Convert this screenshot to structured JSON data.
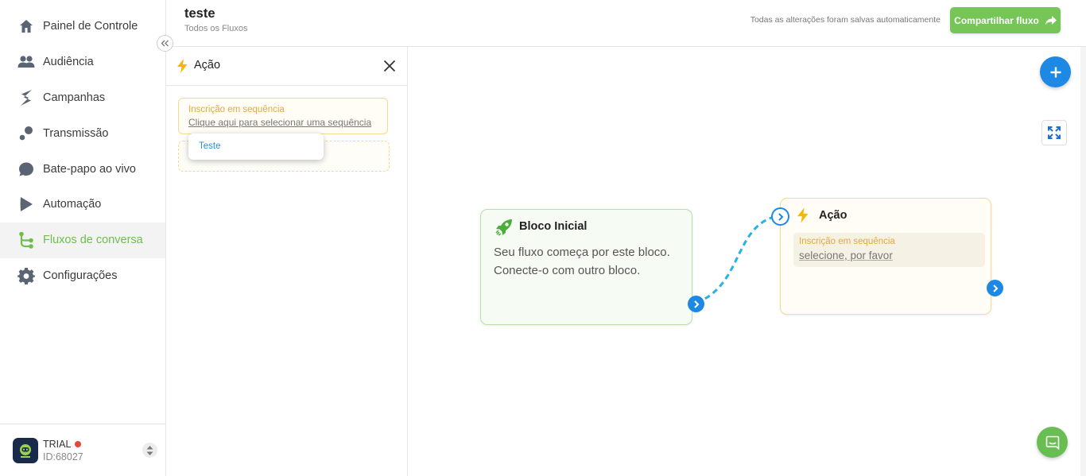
{
  "colors": {
    "accent_green": "#75c656",
    "accent_blue": "#1e88e5",
    "warning": "#e5a935"
  },
  "sidebar": {
    "items": [
      {
        "label": "Painel de Controle",
        "icon": "home-icon"
      },
      {
        "label": "Audiência",
        "icon": "users-icon"
      },
      {
        "label": "Campanhas",
        "icon": "campaign-icon"
      },
      {
        "label": "Transmissão",
        "icon": "broadcast-icon"
      },
      {
        "label": "Bate-papo ao vivo",
        "icon": "chat-bubble-icon"
      },
      {
        "label": "Automação",
        "icon": "automation-icon"
      },
      {
        "label": "Fluxos de conversa",
        "icon": "flow-icon",
        "active": true
      },
      {
        "label": "Configurações",
        "icon": "gear-icon"
      }
    ],
    "account": {
      "plan": "TRIAL",
      "id": "ID:68027"
    }
  },
  "header": {
    "title": "teste",
    "breadcrumb": "Todos os Fluxos",
    "save_status": "Todas as alterações foram salvas automaticamente",
    "share_label": "Compartilhar fluxo"
  },
  "panel": {
    "title": "Ação",
    "sequence_label": "Inscrição em sequência",
    "sequence_link": "Clique aqui para selecionar uma sequência",
    "dropdown_option": "Teste"
  },
  "canvas": {
    "start_block": {
      "title": "Bloco Inicial",
      "description": "Seu fluxo começa por este bloco. Conecte-o com outro bloco."
    },
    "action_block": {
      "title": "Ação",
      "label": "Inscrição em sequência",
      "value": "selecione, por favor"
    }
  }
}
